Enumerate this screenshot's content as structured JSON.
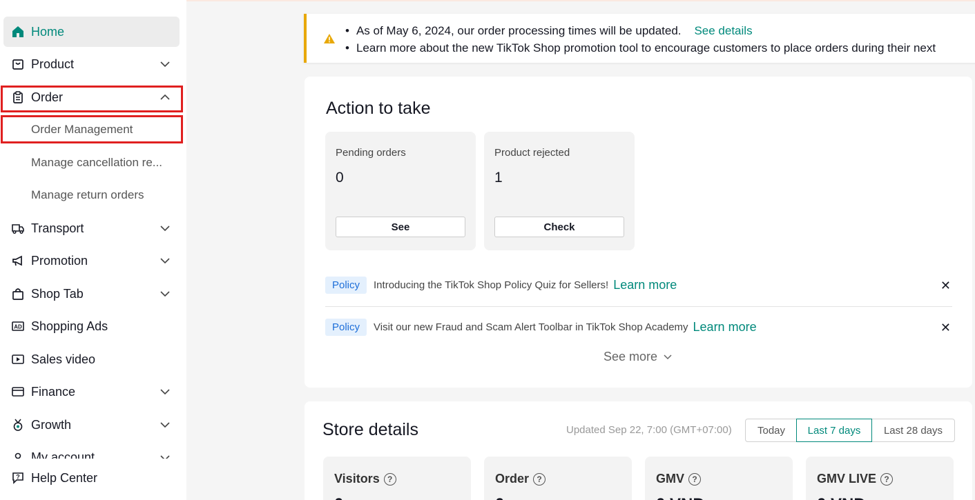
{
  "sidebar": {
    "items": [
      {
        "label": "Home",
        "icon": "home-icon"
      },
      {
        "label": "Product",
        "icon": "product-bag-icon"
      },
      {
        "label": "Order",
        "icon": "clipboard-icon"
      },
      {
        "label": "Transport",
        "icon": "truck-icon"
      },
      {
        "label": "Promotion",
        "icon": "megaphone-icon"
      },
      {
        "label": "Shop Tab",
        "icon": "shop-bag-icon"
      },
      {
        "label": "Shopping Ads",
        "icon": "ad-icon"
      },
      {
        "label": "Sales video",
        "icon": "video-icon"
      },
      {
        "label": "Finance",
        "icon": "wallet-icon"
      },
      {
        "label": "Growth",
        "icon": "medal-icon"
      },
      {
        "label": "My account",
        "icon": "user-icon"
      },
      {
        "label": "Help Center",
        "icon": "help-chat-icon"
      }
    ],
    "order_sub": [
      "Order Management",
      "Manage cancellation re...",
      "Manage return orders"
    ]
  },
  "banner": {
    "line1": "As of May 6, 2024, our order processing times will be updated.",
    "line1_link": "See details",
    "line2": "Learn more about the new TikTok Shop promotion tool to encourage customers to place orders during their next"
  },
  "actions": {
    "title": "Action to take",
    "cards": [
      {
        "title": "Pending orders",
        "value": "0",
        "button": "See"
      },
      {
        "title": "Product rejected",
        "value": "1",
        "button": "Check"
      }
    ],
    "policies": [
      {
        "badge": "Policy",
        "text": "Introducing the TikTok Shop Policy Quiz for Sellers!",
        "link": "Learn more"
      },
      {
        "badge": "Policy",
        "text": "Visit our new Fraud and Scam Alert Toolbar in TikTok Shop Academy",
        "link": "Learn more"
      }
    ],
    "see_more": "See more"
  },
  "store": {
    "title": "Store details",
    "updated": "Updated Sep 22, 7:00 (GMT+07:00)",
    "ranges": [
      "Today",
      "Last 7 days",
      "Last 28 days"
    ],
    "selected_range": "Last 7 days",
    "metrics": [
      "Visitors",
      "Order",
      "GMV",
      "GMV LIVE"
    ]
  },
  "colors": {
    "accent": "#00897b",
    "warning": "#e8a808",
    "highlight_box": "#e02020",
    "policy_badge": "#1e6fd9"
  }
}
